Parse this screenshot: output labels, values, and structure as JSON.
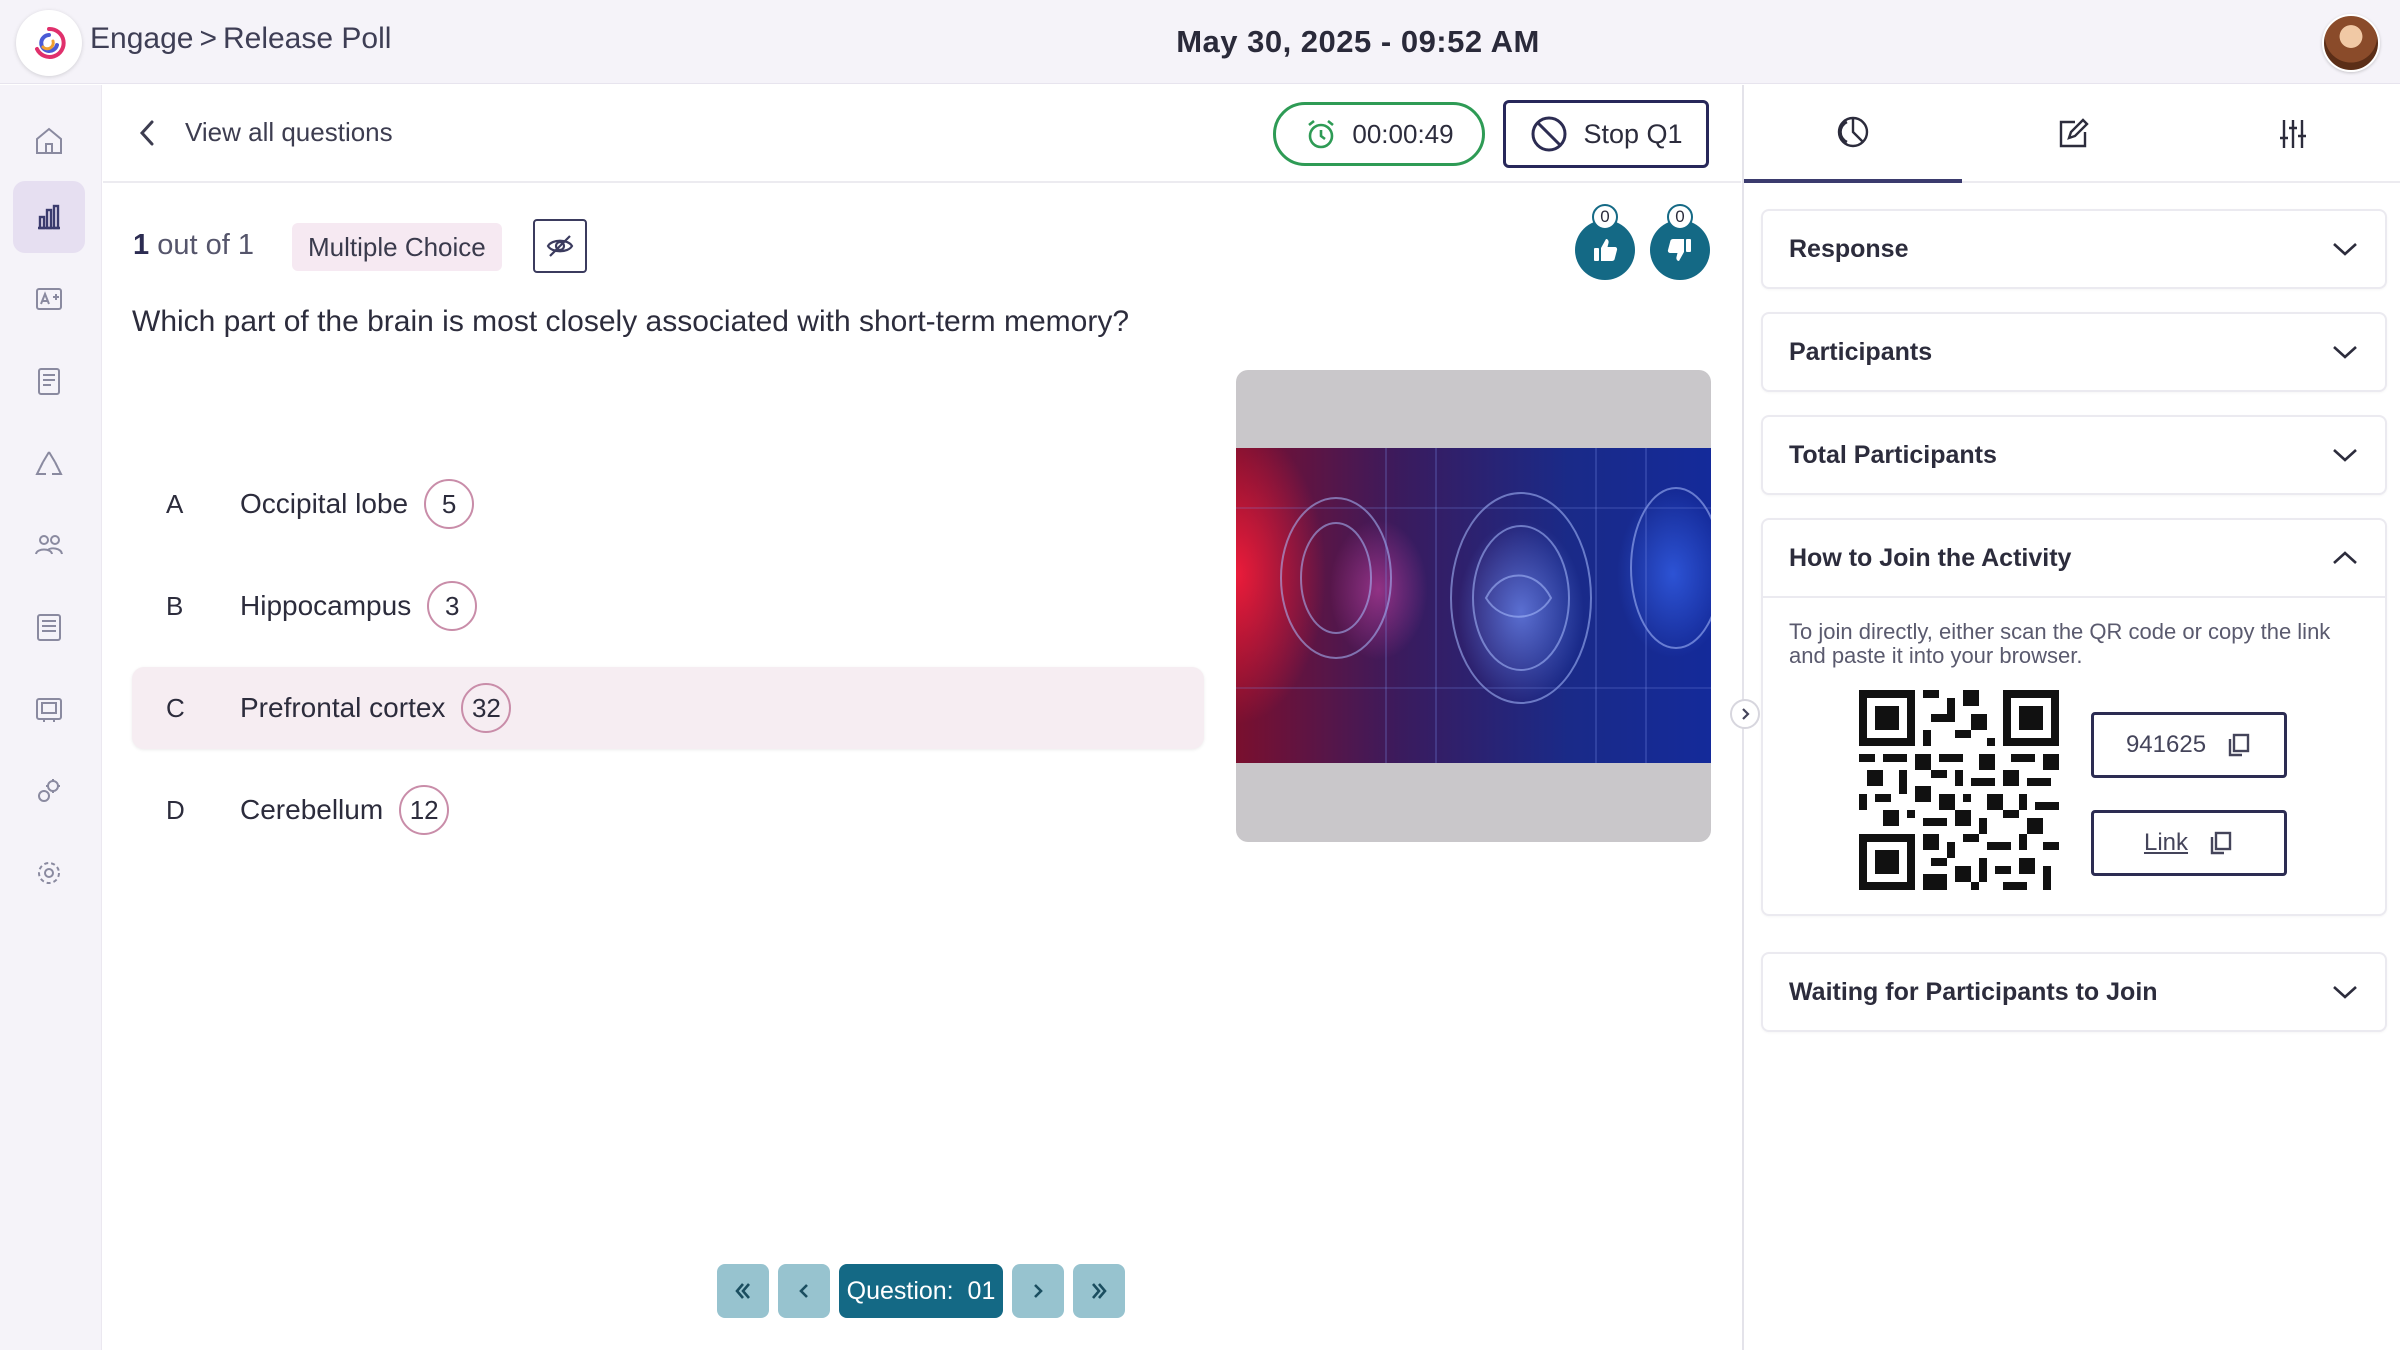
{
  "header": {
    "app_name": "Engage",
    "separator": ">",
    "page_name": "Release Poll",
    "datetime": "May 30, 2025 - 09:52 AM"
  },
  "sidebar": {
    "items": [
      {
        "icon": "home-icon",
        "active": false
      },
      {
        "icon": "bar-chart-icon",
        "active": true
      },
      {
        "icon": "grade-icon",
        "active": false
      },
      {
        "icon": "report-icon",
        "active": false
      },
      {
        "icon": "recycle-icon",
        "active": false
      },
      {
        "icon": "group-icon",
        "active": false
      },
      {
        "icon": "list-icon",
        "active": false
      },
      {
        "icon": "gallery-icon",
        "active": false
      },
      {
        "icon": "integrations-icon",
        "active": false
      },
      {
        "icon": "settings-icon",
        "active": false
      }
    ]
  },
  "main": {
    "back_label": "View all questions",
    "timer": "00:00:49",
    "stop_label": "Stop Q1",
    "question_index": "1",
    "question_total_text": "out of 1",
    "question_type": "Multiple Choice",
    "likes": "0",
    "dislikes": "0",
    "question_text": "Which part of the brain is most closely associated with short-term memory?",
    "options": [
      {
        "letter": "A",
        "label": "Occipital lobe",
        "count": "5",
        "highlighted": false
      },
      {
        "letter": "B",
        "label": "Hippocampus",
        "count": "3",
        "highlighted": false
      },
      {
        "letter": "C",
        "label": "Prefrontal cortex",
        "count": "32",
        "highlighted": true
      },
      {
        "letter": "D",
        "label": "Cerebellum",
        "count": "12",
        "highlighted": false
      }
    ],
    "pager": {
      "current_label": "Question:",
      "current_value": "01"
    }
  },
  "right_panel": {
    "tabs": [
      {
        "icon": "pie-chart-icon",
        "active": true
      },
      {
        "icon": "edit-icon",
        "active": false
      },
      {
        "icon": "sliders-icon",
        "active": false
      }
    ],
    "sections": {
      "response": "Response",
      "participants": "Participants",
      "total_participants": "Total Participants",
      "how_to_join": "How to Join the Activity",
      "waiting": "Waiting for Participants to Join"
    },
    "join_instructions": "To join directly, either scan the QR code or copy the link and paste it into your browser.",
    "join_code": "941625",
    "link_label": "Link"
  },
  "colors": {
    "accent_teal": "#146985",
    "timer_green": "#2e9b55",
    "highlight_pink": "#f6edf2",
    "navy": "#2c2c52"
  }
}
